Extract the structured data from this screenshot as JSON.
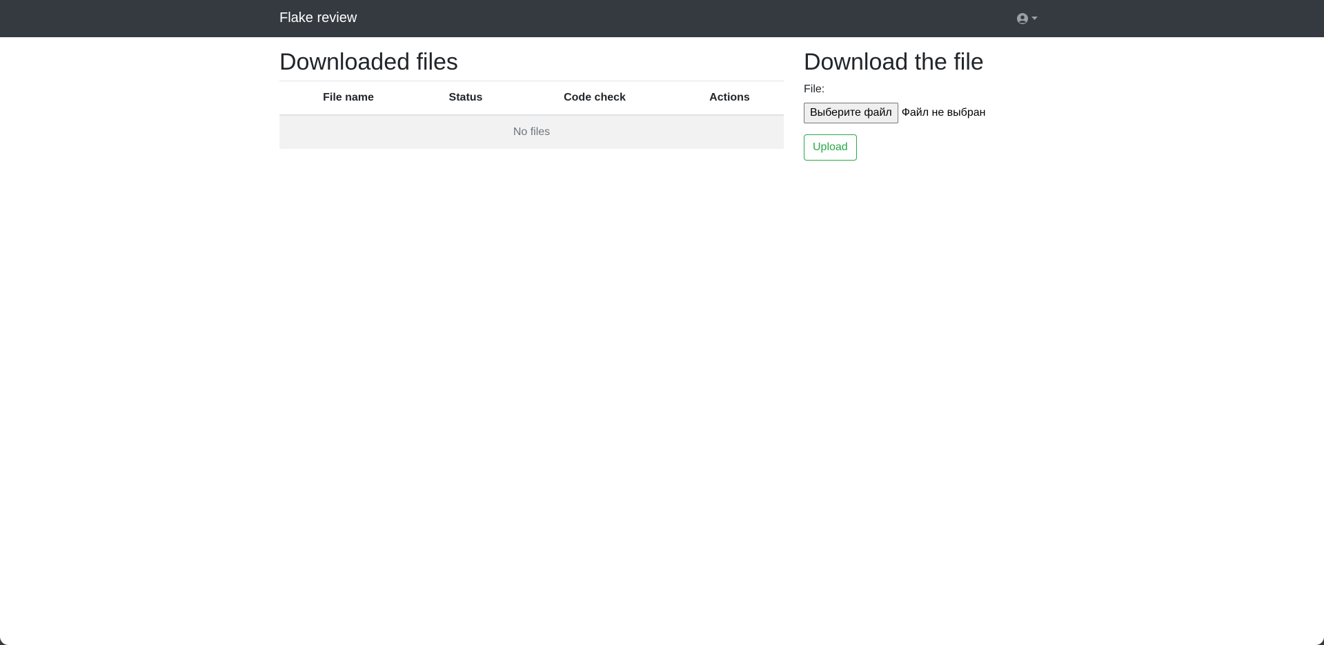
{
  "navbar": {
    "brand": "Flake review",
    "user_icon": "user-circle-icon",
    "caret_icon": "caret-down-icon"
  },
  "files_section": {
    "title": "Downloaded files",
    "columns": [
      "File name",
      "Status",
      "Code check",
      "Actions"
    ],
    "empty_message": "No files"
  },
  "upload_section": {
    "title": "Download the file",
    "file_label": "File:",
    "choose_button": "Выберите файл",
    "no_file_text": "Файл не выбран",
    "upload_button": "Upload"
  },
  "colors": {
    "navbar_bg": "#343a40",
    "success": "#28a745",
    "empty_row_bg": "#f2f2f2"
  }
}
